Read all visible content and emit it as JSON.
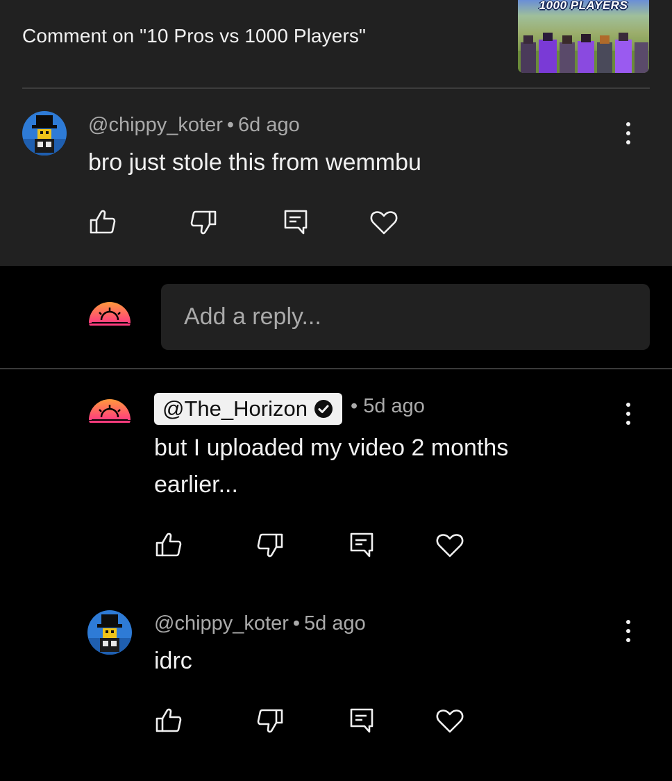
{
  "header": {
    "title": "Comment on \"10 Pros vs 1000 Players\"",
    "thumbnail_text": "1000 PLAYERS"
  },
  "main_comment": {
    "author": "@chippy_koter",
    "time": "6d ago",
    "text": "bro just stole this from wemmbu",
    "actions": [
      "like-icon",
      "dislike-icon",
      "reply-icon",
      "heart-icon"
    ]
  },
  "reply_input": {
    "placeholder": "Add a reply..."
  },
  "replies": [
    {
      "author": "@The_Horizon",
      "verified": true,
      "time": "5d ago",
      "text_line1": "but I uploaded my video 2 months",
      "text_line2": "earlier..."
    },
    {
      "author": "@chippy_koter",
      "time": "5d ago",
      "text": "idrc"
    }
  ],
  "colors": {
    "background": "#000000",
    "panel": "#212121",
    "text_primary": "#f1f1f1",
    "text_secondary": "#aaaaaa",
    "horizon_gradient_top": "#ff9a3c",
    "horizon_gradient_bottom": "#ff3d7f"
  }
}
